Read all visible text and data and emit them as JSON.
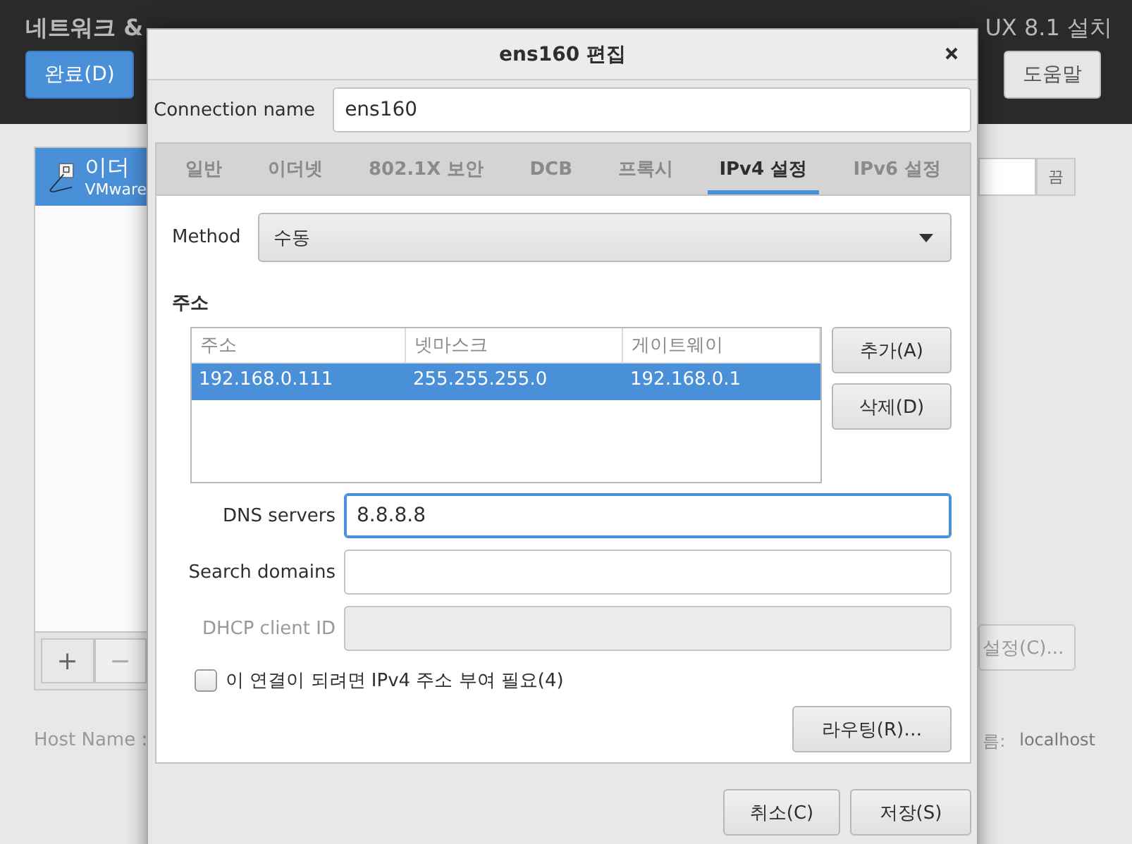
{
  "background": {
    "header": {
      "title": "네트워크 &",
      "done_button": "완료(D)",
      "product_title": "UX 8.1 설치",
      "help_button": "도움말"
    },
    "device_list": {
      "items": [
        {
          "name": "이더",
          "subtitle": "VMware",
          "selected": true
        }
      ],
      "add_button": "+",
      "remove_button": "−"
    },
    "toggle_button": "끔",
    "configure_button": "설정(C)...",
    "host_name_label": "Host Name :",
    "host_name_label_end": "름:",
    "host_name_value": "localhost"
  },
  "dialog": {
    "title": "ens160 편집",
    "connection_name": {
      "label": "Connection name",
      "value": "ens160"
    },
    "tabs": [
      {
        "label": "일반",
        "selected": false
      },
      {
        "label": "이더넷",
        "selected": false
      },
      {
        "label": "802.1X 보안",
        "selected": false
      },
      {
        "label": "DCB",
        "selected": false
      },
      {
        "label": "프록시",
        "selected": false
      },
      {
        "label": "IPv4 설정",
        "selected": true
      },
      {
        "label": "IPv6 설정",
        "selected": false
      }
    ],
    "method": {
      "label": "Method",
      "value": "수동"
    },
    "addresses": {
      "heading": "주소",
      "columns": [
        "주소",
        "넷마스크",
        "게이트웨이"
      ],
      "rows": [
        {
          "cells": [
            "192.168.0.111",
            "255.255.255.0",
            "192.168.0.1"
          ],
          "selected": true
        }
      ],
      "buttons": [
        "추가(A)",
        "삭제(D)"
      ]
    },
    "fields": [
      {
        "label": "DNS servers",
        "value": "8.8.8.8",
        "focused": true,
        "disabled": false
      },
      {
        "label": "Search domains",
        "focused": false,
        "disabled": false
      },
      {
        "label": "DHCP client ID",
        "focused": false,
        "disabled": true
      }
    ],
    "require_ipv4": {
      "label": "이 연결이 되려면 IPv4 주소 부여 필요(4)",
      "checked": false
    },
    "routes_button": "라우팅(R)…",
    "footer_buttons": [
      "취소(C)",
      "저장(S)"
    ]
  }
}
